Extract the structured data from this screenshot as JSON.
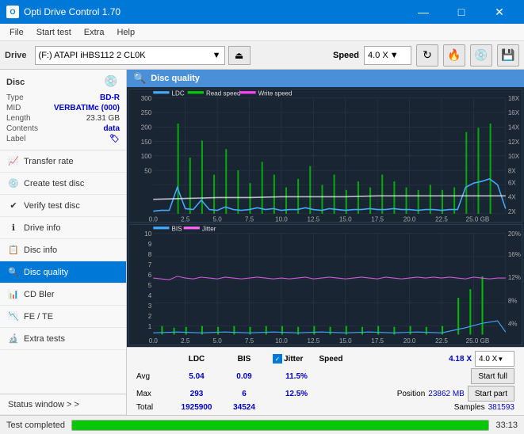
{
  "titlebar": {
    "title": "Opti Drive Control 1.70",
    "icon_text": "O",
    "minimize": "—",
    "maximize": "□",
    "close": "✕"
  },
  "menubar": {
    "items": [
      "File",
      "Start test",
      "Extra",
      "Help"
    ]
  },
  "toolbar": {
    "drive_label": "Drive",
    "drive_value": "(F:)  ATAPI iHBS112  2 CL0K",
    "speed_label": "Speed",
    "speed_value": "4.0 X",
    "eject_icon": "⏏"
  },
  "sidebar": {
    "disc_title": "Disc",
    "disc_icon": "💿",
    "type_label": "Type",
    "type_value": "BD-R",
    "mid_label": "MID",
    "mid_value": "VERBATIMc (000)",
    "length_label": "Length",
    "length_value": "23.31 GB",
    "contents_label": "Contents",
    "contents_value": "data",
    "label_label": "Label",
    "label_icon": "🏷",
    "nav_items": [
      {
        "label": "Transfer rate",
        "icon": "📈",
        "active": false
      },
      {
        "label": "Create test disc",
        "icon": "💿",
        "active": false
      },
      {
        "label": "Verify test disc",
        "icon": "✔",
        "active": false
      },
      {
        "label": "Drive info",
        "icon": "ℹ",
        "active": false
      },
      {
        "label": "Disc info",
        "icon": "📋",
        "active": false
      },
      {
        "label": "Disc quality",
        "icon": "🔍",
        "active": true
      },
      {
        "label": "CD Bler",
        "icon": "📊",
        "active": false
      },
      {
        "label": "FE / TE",
        "icon": "📉",
        "active": false
      },
      {
        "label": "Extra tests",
        "icon": "🔬",
        "active": false
      }
    ],
    "status_window": "Status window > >"
  },
  "quality": {
    "title": "Disc quality",
    "chart1": {
      "legend": [
        {
          "label": "LDC",
          "color": "#00aaff"
        },
        {
          "label": "Read speed",
          "color": "#00ff00"
        },
        {
          "label": "Write speed",
          "color": "#ff44ff"
        }
      ],
      "y_max": 300,
      "y_right_labels": [
        "18X",
        "16X",
        "14X",
        "12X",
        "10X",
        "8X",
        "6X",
        "4X",
        "2X"
      ],
      "x_labels": [
        "0.0",
        "2.5",
        "5.0",
        "7.5",
        "10.0",
        "12.5",
        "15.0",
        "17.5",
        "20.0",
        "22.5",
        "25.0 GB"
      ]
    },
    "chart2": {
      "legend": [
        {
          "label": "BIS",
          "color": "#00aaff"
        },
        {
          "label": "Jitter",
          "color": "#ff44ff"
        }
      ],
      "y_max": 10,
      "y_right_labels": [
        "20%",
        "16%",
        "12%",
        "8%",
        "4%"
      ],
      "x_labels": [
        "0.0",
        "2.5",
        "5.0",
        "7.5",
        "10.0",
        "12.5",
        "15.0",
        "17.5",
        "20.0",
        "22.5",
        "25.0 GB"
      ]
    }
  },
  "stats": {
    "headers": [
      "LDC",
      "BIS",
      "",
      "Jitter",
      "Speed"
    ],
    "avg_label": "Avg",
    "avg_ldc": "5.04",
    "avg_bis": "0.09",
    "avg_jitter": "11.5%",
    "avg_speed": "4.18 X",
    "max_label": "Max",
    "max_ldc": "293",
    "max_bis": "6",
    "max_jitter": "12.5%",
    "total_label": "Total",
    "total_ldc": "1925900",
    "total_bis": "34524",
    "position_label": "Position",
    "position_value": "23862 MB",
    "samples_label": "Samples",
    "samples_value": "381593",
    "speed_label": "4.0 X",
    "start_full_label": "Start full",
    "start_part_label": "Start part",
    "jitter_checked": true
  },
  "bottom": {
    "status_text": "Test completed",
    "progress_pct": 100,
    "time_text": "33:13"
  }
}
